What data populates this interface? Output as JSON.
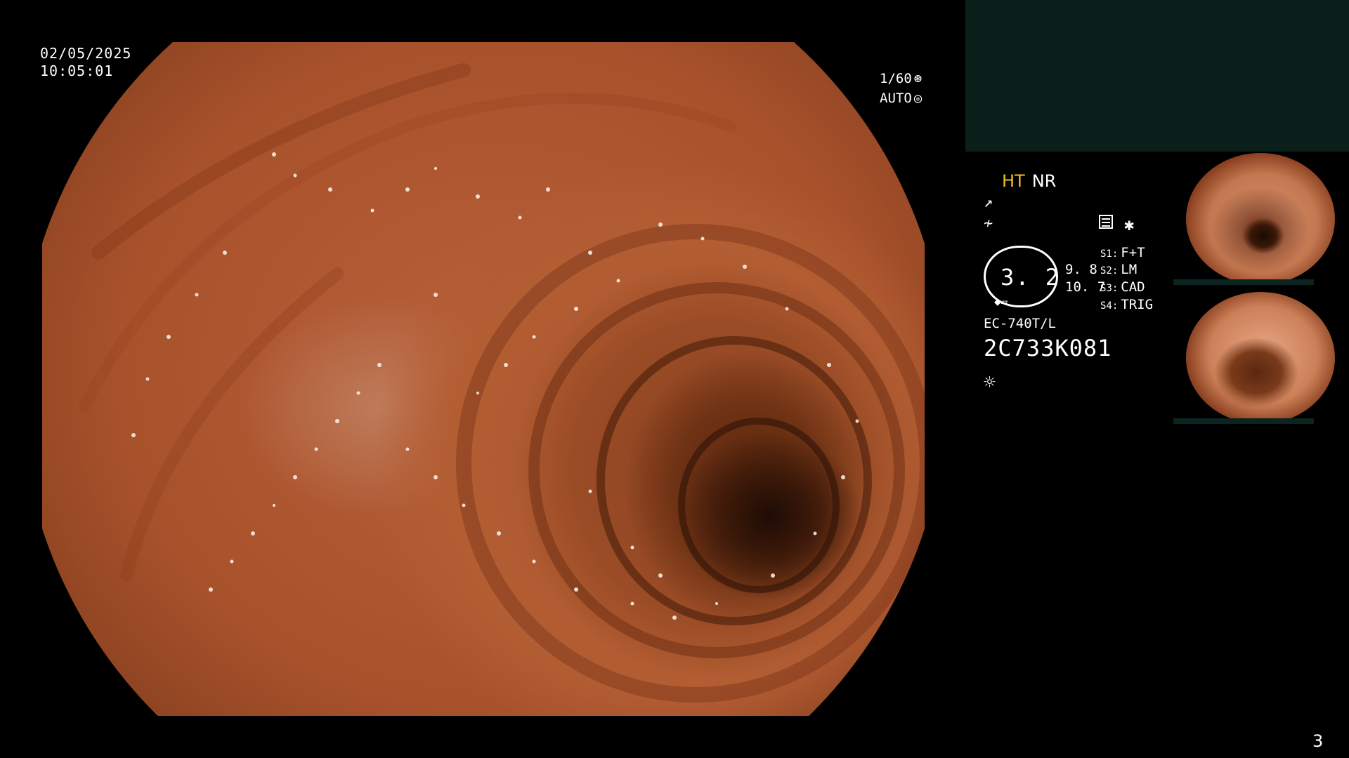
{
  "overlay": {
    "date": "02/05/2025",
    "time": "10:05:01",
    "shutter": "1/60",
    "shutter_icon": "aperture-icon",
    "exposure_mode": "AUTO",
    "exposure_icon": "iris-icon"
  },
  "panel": {
    "mode_ht": "HT",
    "mode_nr": "NR",
    "enhance_icon": "enhance-icon",
    "filter_icon": "filter-icon",
    "zoom_value": "3. 2",
    "stat_a": "9. 8",
    "stat_b": "10. 7",
    "switches": [
      {
        "key": "S1:",
        "value": "F+T"
      },
      {
        "key": "S2:",
        "value": "LM"
      },
      {
        "key": "S3:",
        "value": "CAD"
      },
      {
        "key": "S4:",
        "value": "TRIG"
      }
    ],
    "scope_model": "EC-740T/L",
    "scope_serial": "2C733K081",
    "light_icon": "light-source-icon"
  },
  "colors": {
    "ht_accent": "#f0c020",
    "top_panel": "#0a1e1a",
    "mucosa": "#b35d33"
  },
  "page_number": "3"
}
